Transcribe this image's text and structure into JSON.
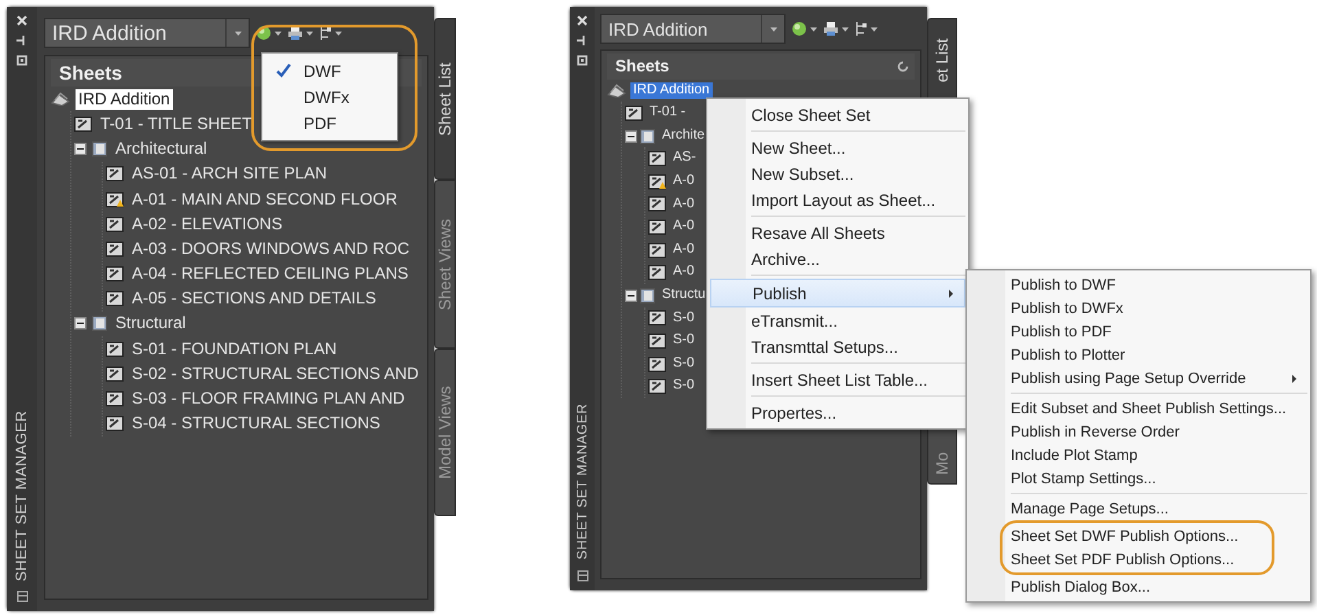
{
  "panels": [
    {
      "side_title": "SHEET SET MANAGER",
      "set_dropdown": "IRD Addition",
      "tree_header": "Sheets",
      "tree_focused": false,
      "tree": [
        {
          "label": "IRD Addition",
          "kind": "set",
          "selected": true,
          "children": [
            {
              "label": "T-01 - TITLE SHEET",
              "kind": "sheet",
              "selected": false
            },
            {
              "label": "Architectural",
              "kind": "subset",
              "expanded": true,
              "selected": false,
              "children": [
                {
                  "label": "AS-01 - ARCH SITE PLAN",
                  "kind": "sheet",
                  "selected": false
                },
                {
                  "label": "A-01 - MAIN AND SECOND FLOOR",
                  "kind": "sheet-warning",
                  "selected": false
                },
                {
                  "label": "A-02 - ELEVATIONS",
                  "kind": "sheet",
                  "selected": false
                },
                {
                  "label": "A-03 - DOORS WINDOWS AND ROC",
                  "kind": "sheet",
                  "selected": false
                },
                {
                  "label": "A-04 - REFLECTED CEILING PLANS",
                  "kind": "sheet",
                  "selected": false
                },
                {
                  "label": "A-05 - SECTIONS AND DETAILS",
                  "kind": "sheet",
                  "selected": false
                }
              ]
            },
            {
              "label": "Structural",
              "kind": "subset",
              "expanded": true,
              "selected": false,
              "children": [
                {
                  "label": "S-01 - FOUNDATION PLAN",
                  "kind": "sheet",
                  "selected": false
                },
                {
                  "label": "S-02 - STRUCTURAL SECTIONS AND",
                  "kind": "sheet",
                  "selected": false
                },
                {
                  "label": "S-03 - FLOOR FRAMING PLAN AND",
                  "kind": "sheet",
                  "selected": false
                },
                {
                  "label": "S-04 - STRUCTURAL SECTIONS",
                  "kind": "sheet",
                  "selected": false
                }
              ]
            }
          ]
        }
      ],
      "tabs": [
        {
          "label": "Sheet List",
          "selected": true
        },
        {
          "label": "Sheet Views",
          "selected": false
        },
        {
          "label": "Model Views",
          "selected": false
        }
      ],
      "format_menu": [
        {
          "label": "DWF",
          "checked": true
        },
        {
          "label": "DWFx",
          "checked": false
        },
        {
          "label": "PDF",
          "checked": false
        }
      ]
    },
    {
      "side_title": "SHEET SET MANAGER",
      "set_dropdown": "IRD Addition",
      "tree_header": "Sheets",
      "tree_focused": true,
      "tree": [
        {
          "label": "IRD Addition",
          "kind": "set",
          "selected": true,
          "children": [
            {
              "label": "T-01 -",
              "kind": "sheet",
              "selected": false
            },
            {
              "label": "Archite",
              "kind": "subset",
              "expanded": true,
              "selected": false,
              "children": [
                {
                  "label": "AS-",
                  "kind": "sheet",
                  "selected": false
                },
                {
                  "label": "A-0",
                  "kind": "sheet-warning",
                  "selected": false
                },
                {
                  "label": "A-0",
                  "kind": "sheet",
                  "selected": false
                },
                {
                  "label": "A-0",
                  "kind": "sheet",
                  "selected": false
                },
                {
                  "label": "A-0",
                  "kind": "sheet",
                  "selected": false
                },
                {
                  "label": "A-0",
                  "kind": "sheet",
                  "selected": false
                }
              ]
            },
            {
              "label": "Structu",
              "kind": "subset",
              "expanded": true,
              "selected": false,
              "children": [
                {
                  "label": "S-0",
                  "kind": "sheet",
                  "selected": false
                },
                {
                  "label": "S-0",
                  "kind": "sheet",
                  "selected": false
                },
                {
                  "label": "S-0",
                  "kind": "sheet",
                  "selected": false
                },
                {
                  "label": "S-0",
                  "kind": "sheet",
                  "selected": false
                }
              ]
            }
          ]
        }
      ],
      "tabs": [
        {
          "label": "et List",
          "selected": true
        },
        {
          "label": "Mo",
          "selected": false
        }
      ],
      "context_menu": [
        [
          {
            "label": "Close Sheet Set",
            "selected": false,
            "submenu": false
          }
        ],
        [
          {
            "label": "New Sheet...",
            "selected": false,
            "submenu": false
          },
          {
            "label": "New Subset...",
            "selected": false,
            "submenu": false
          },
          {
            "label": "Import Layout as Sheet...",
            "selected": false,
            "submenu": false
          }
        ],
        [
          {
            "label": "Resave All Sheets",
            "selected": false,
            "submenu": false
          },
          {
            "label": "Archive...",
            "selected": false,
            "submenu": false
          }
        ],
        [
          {
            "label": "Publish",
            "selected": true,
            "submenu": true
          },
          {
            "label": "eTransmit...",
            "selected": false,
            "submenu": false
          },
          {
            "label": "Transmttal Setups...",
            "selected": false,
            "submenu": false
          }
        ],
        [
          {
            "label": "Insert Sheet List Table...",
            "selected": false,
            "submenu": false
          }
        ],
        [
          {
            "label": "Propertes...",
            "selected": false,
            "submenu": false
          }
        ]
      ],
      "publish_submenu": [
        [
          {
            "label": "Publish to DWF",
            "submenu": false
          },
          {
            "label": "Publish to DWFx",
            "submenu": false
          },
          {
            "label": "Publish to PDF",
            "submenu": false
          },
          {
            "label": "Publish to Plotter",
            "submenu": false
          },
          {
            "label": "Publish using Page Setup Override",
            "submenu": true
          }
        ],
        [
          {
            "label": "Edit Subset and Sheet Publish Settings...",
            "submenu": false
          },
          {
            "label": "Publish in Reverse Order",
            "submenu": false
          },
          {
            "label": "Include Plot Stamp",
            "submenu": false
          },
          {
            "label": "Plot Stamp Settings...",
            "submenu": false
          }
        ],
        [
          {
            "label": "Manage Page Setups...",
            "submenu": false
          },
          {
            "label": "Sheet Set DWF Publish Options...",
            "submenu": false,
            "circled": true
          },
          {
            "label": "Sheet Set PDF Publish Options...",
            "submenu": false,
            "circled": true
          },
          {
            "label": "Publish Dialog Box...",
            "submenu": false
          }
        ]
      ]
    }
  ]
}
